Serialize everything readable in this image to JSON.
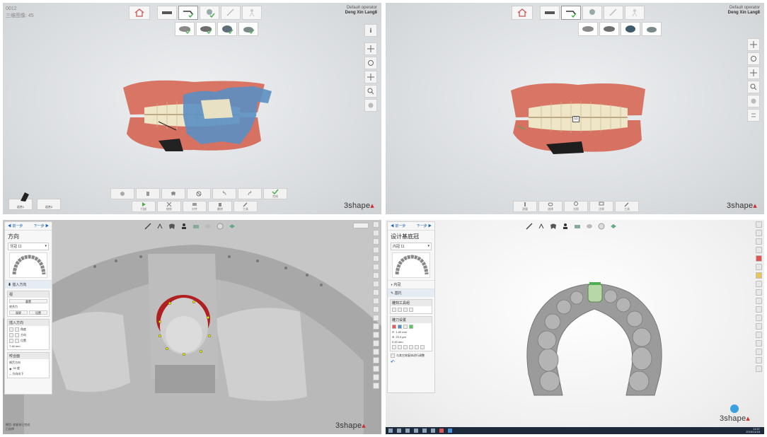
{
  "q1": {
    "header_left": [
      "0012",
      "三维图像: 45"
    ],
    "operator_label": "Default operator",
    "user": "Deng Xin Lang8",
    "toolbar_bottom_top": [
      "",
      "",
      "",
      "",
      "",
      "",
      "",
      "",
      "完成"
    ],
    "toolbar_bottom": [
      "扫描",
      "修剪",
      "对齐",
      "删除",
      "工具"
    ],
    "status_left": [
      "适合1",
      "适合2"
    ],
    "brand": "3shape"
  },
  "q2": {
    "operator_label": "Default operator",
    "user": "Deng Xin Lang8",
    "toolbar_bottom": [
      "测量",
      "选择",
      "光照",
      "注释",
      "工具"
    ],
    "tooth_label": "11",
    "brand": "3shape"
  },
  "q3": {
    "nav_prev": "前一步",
    "nav_next": "下一步",
    "panel_title": "方向",
    "select_value": "牙冠 11",
    "item_insertion": "插入方向",
    "sec1_title": "视",
    "sec1_btn": "重置",
    "sec1_sub": "咬合力",
    "sec1_btns": [
      "观察",
      "设置"
    ],
    "sec2_title": "插入方向",
    "sec2_fields": [
      "角度",
      "方向",
      "位置"
    ],
    "sec2_value": "7.46 mm",
    "sec3_title": "咬合面",
    "sec3_opts": [
      "颊舌方向",
      "90 度",
      "方向向下"
    ],
    "status_left": [
      "模型: 修复体已完成",
      "已选择"
    ],
    "brand": "3shape"
  },
  "q4": {
    "nav_prev": "前一步",
    "nav_next": "下一步",
    "panel_title": "设计基底冠",
    "select_value": "内冠 11",
    "item1": "内冠",
    "item2": "基托",
    "sec_title": "雕刻工具组",
    "sec2_title": "雕刀设置",
    "val1": "1.00 mm",
    "val2": "20.0 µm",
    "val3": "0.00 mm",
    "checkbox": "与其它修复体进行调整",
    "taskbar_time": "11:57",
    "taskbar_date": "2019/11/18",
    "brand": "3shape"
  },
  "colors": {
    "accent_red": "#d03030",
    "gingiva": "#e07a68",
    "scan_blue": "#4e84b8",
    "stone_gray": "#9b9b9b",
    "green_check": "#4caf50",
    "taskbar": "#1c2a3c"
  }
}
